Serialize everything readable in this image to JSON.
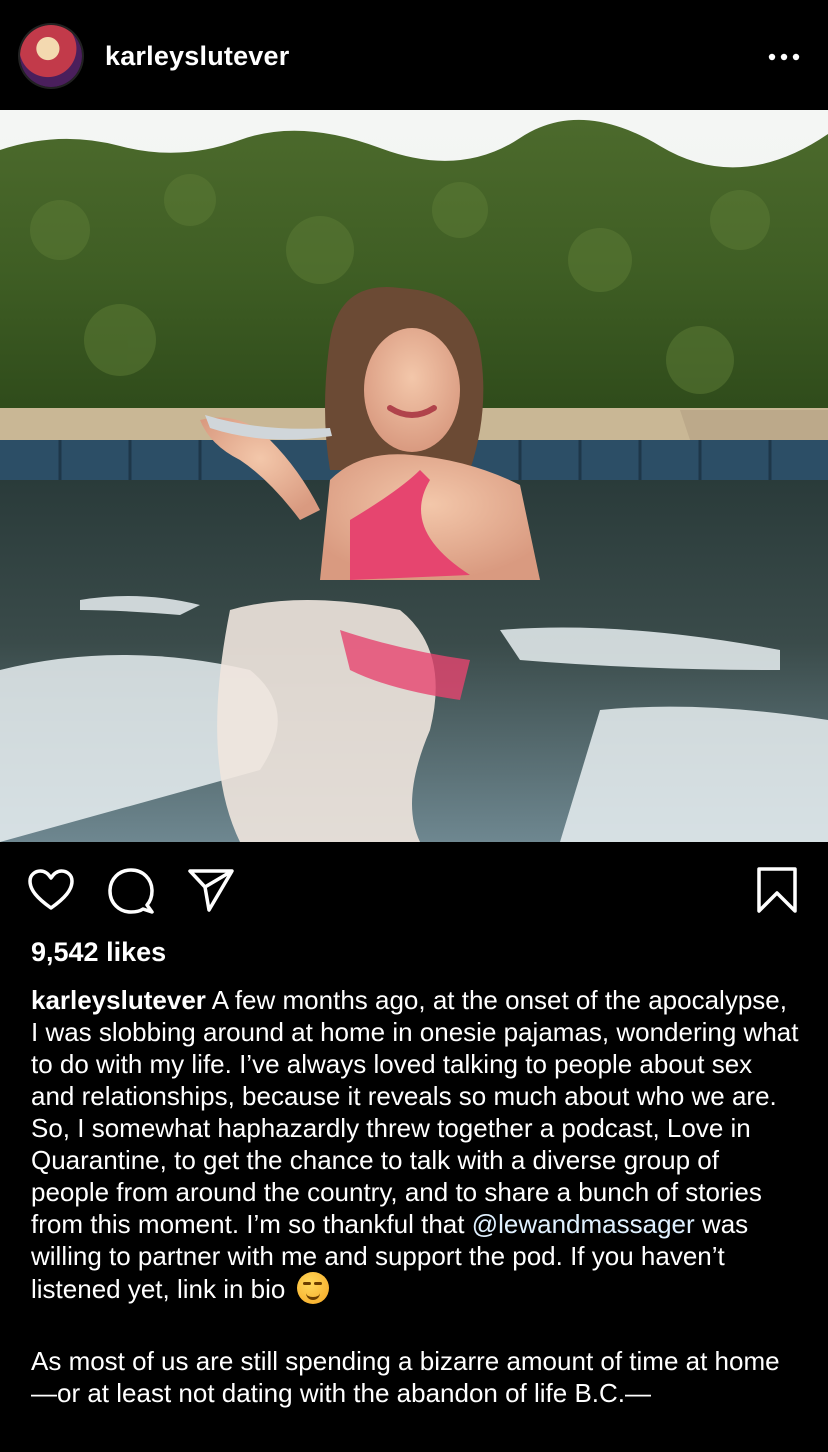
{
  "post": {
    "username": "karleyslutever",
    "likes": "9,542 likes"
  },
  "icons": {
    "more": "more-dots-icon",
    "like": "heart-icon",
    "comment": "comment-bubble-icon",
    "share": "paper-plane-icon",
    "save": "bookmark-icon"
  },
  "caption": {
    "username": "karleyslutever",
    "text_before_mention": "A few months ago, at the onset of the apocalypse, I was slobbing around at home in onesie pajamas, wondering what to do with my life. I’ve always loved talking to people about sex and relationships, because it reveals so much about who we are. So, I somewhat haphazardly threw together a podcast, Love in Quarantine, to get the chance to talk with a diverse group of people from around the country, and to share a bunch of stories from this moment. I’m so thankful that",
    "mention": "@lewandmassager",
    "text_after_mention": "was willing to partner with me and support the pod. If you haven’t listened yet, link in bio",
    "emoji": "smirking-face-emoji",
    "paragraph2": "As most of us are still spending a bizarre amount of time at home—or at least not dating with the abandon of life B.C.—"
  },
  "colors": {
    "background": "#000000",
    "text": "#ffffff",
    "mention": "#e0f1ff"
  }
}
